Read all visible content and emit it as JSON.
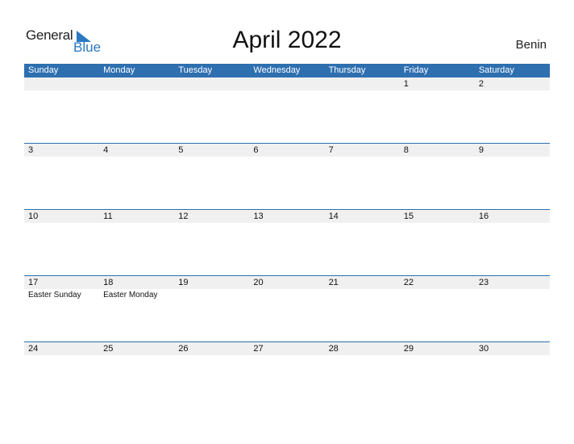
{
  "logo": {
    "general": "General",
    "blue": "Blue"
  },
  "title": "April 2022",
  "country": "Benin",
  "weekdays": [
    "Sunday",
    "Monday",
    "Tuesday",
    "Wednesday",
    "Thursday",
    "Friday",
    "Saturday"
  ],
  "weeks": [
    {
      "dates": [
        "",
        "",
        "",
        "",
        "",
        "1",
        "2"
      ],
      "events": [
        "",
        "",
        "",
        "",
        "",
        "",
        ""
      ]
    },
    {
      "dates": [
        "3",
        "4",
        "5",
        "6",
        "7",
        "8",
        "9"
      ],
      "events": [
        "",
        "",
        "",
        "",
        "",
        "",
        ""
      ]
    },
    {
      "dates": [
        "10",
        "11",
        "12",
        "13",
        "14",
        "15",
        "16"
      ],
      "events": [
        "",
        "",
        "",
        "",
        "",
        "",
        ""
      ]
    },
    {
      "dates": [
        "17",
        "18",
        "19",
        "20",
        "21",
        "22",
        "23"
      ],
      "events": [
        "Easter Sunday",
        "Easter Monday",
        "",
        "",
        "",
        "",
        ""
      ]
    },
    {
      "dates": [
        "24",
        "25",
        "26",
        "27",
        "28",
        "29",
        "30"
      ],
      "events": [
        "",
        "",
        "",
        "",
        "",
        "",
        ""
      ]
    }
  ],
  "colors": {
    "header": "#2e6fb0",
    "date_strip": "#f0f0f0",
    "brand": "#2a78c2"
  }
}
